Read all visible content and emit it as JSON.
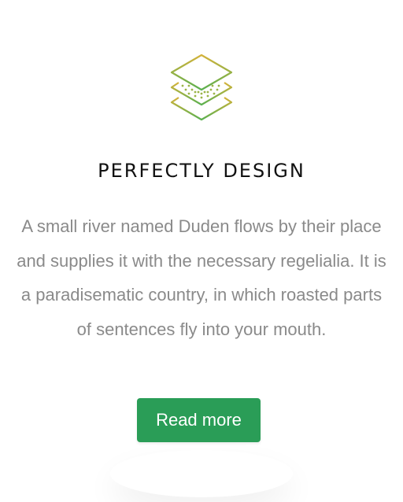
{
  "feature": {
    "icon": "layers-icon",
    "title": "PERFECTLY DESIGN",
    "description": "A small river named Duden flows by their place and supplies it with the necessary regelialia. It is a paradisematic country, in which roasted parts of sentences fly into your mouth.",
    "button_label": "Read more"
  },
  "colors": {
    "icon_gradient_start": "#d4b23a",
    "icon_gradient_end": "#5ab04f",
    "button_bg": "#2a9d57",
    "title": "#111111",
    "body_text": "#8a8a8a"
  }
}
